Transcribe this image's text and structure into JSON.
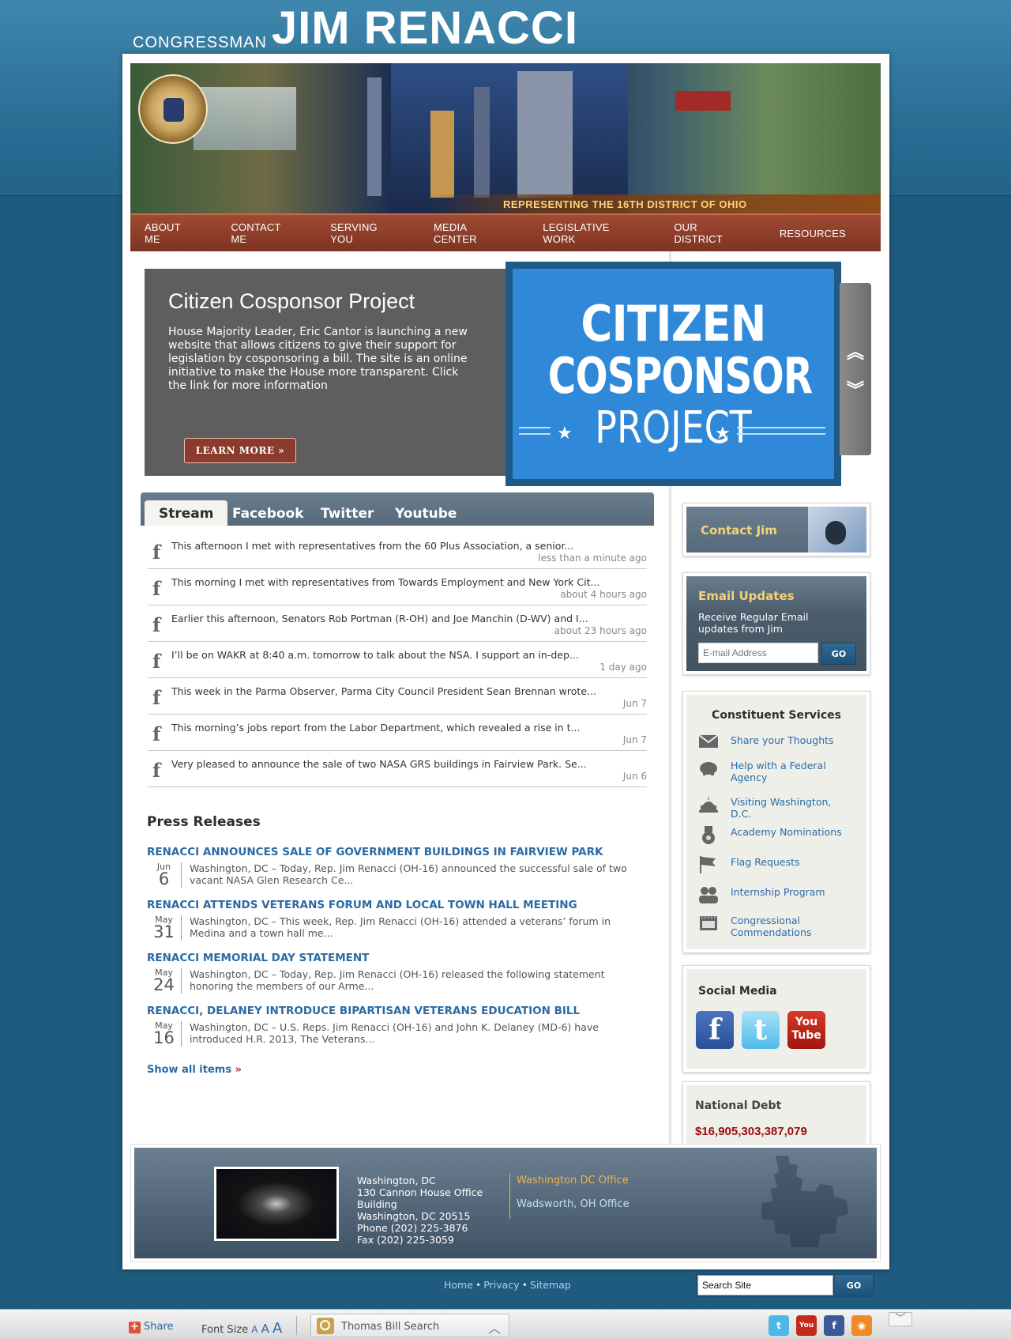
{
  "masthead": {
    "prefix": "CONGRESSMAN",
    "name": "JIM RENACCI"
  },
  "banner": {
    "district": "REPRESENTING THE 16TH DISTRICT OF OHIO"
  },
  "nav": [
    "ABOUT ME",
    "CONTACT ME",
    "SERVING YOU",
    "MEDIA CENTER",
    "LEGISLATIVE WORK",
    "OUR DISTRICT",
    "RESOURCES"
  ],
  "feature": {
    "title": "Citizen Cosponsor Project",
    "body": "House Majority Leader, Eric Cantor is launching a new website that allows citizens to give their support for legislation by cosponsoring a bill. The site is an online initiative to make the House more transparent. Click the link for more information",
    "button": "LEARN MORE »",
    "image_lines": [
      "CITIZEN",
      "COSPONSOR",
      "PROJECT"
    ],
    "up_icon": "double-chevron-up-icon",
    "down_icon": "double-chevron-down-icon"
  },
  "tabs": [
    "Stream",
    "Facebook",
    "Twitter",
    "Youtube"
  ],
  "stream": [
    {
      "text": "This afternoon I met with representatives from the 60 Plus Association, a senior...",
      "ago": "less than a minute ago"
    },
    {
      "text": "This morning I met with representatives from Towards Employment and New York Cit...",
      "ago": "about 4 hours ago"
    },
    {
      "text": "Earlier this afternoon, Senators Rob Portman (R-OH) and Joe Manchin (D-WV) and I...",
      "ago": "about 23 hours ago"
    },
    {
      "text": "I’ll be on WAKR at 8:40 a.m. tomorrow to talk about the NSA. I support an in-dep...",
      "ago": "1 day ago"
    },
    {
      "text": "This week in the Parma Observer, Parma City Council President Sean Brennan wrote...",
      "ago": "Jun 7"
    },
    {
      "text": "This morning’s jobs report from the Labor Department, which revealed a rise in t...",
      "ago": "Jun 7"
    },
    {
      "text": "Very pleased to announce the sale of two NASA GRS buildings in Fairview Park. Se...",
      "ago": "Jun 6"
    }
  ],
  "press": {
    "heading": "Press Releases",
    "items": [
      {
        "title": "RENACCI ANNOUNCES SALE OF GOVERNMENT BUILDINGS IN FAIRVIEW PARK",
        "month": "Jun",
        "day": "6",
        "summary": "Washington, DC – Today, Rep. Jim Renacci (OH-16) announced the successful sale of two vacant NASA Glen Research Ce..."
      },
      {
        "title": "RENACCI ATTENDS VETERANS FORUM AND LOCAL TOWN HALL MEETING",
        "month": "May",
        "day": "31",
        "summary": "Washington, DC – This week, Rep. Jim Renacci (OH-16) attended a veterans’ forum in Medina and a town hall me..."
      },
      {
        "title": "RENACCI MEMORIAL DAY STATEMENT",
        "month": "May",
        "day": "24",
        "summary": "Washington, DC – Today, Rep. Jim Renacci (OH-16) released the following statement honoring the members of our Arme..."
      },
      {
        "title": "RENACCI, DELANEY INTRODUCE BIPARTISAN VETERANS EDUCATION BILL",
        "month": "May",
        "day": "16",
        "summary": "Washington, DC – U.S. Reps. Jim Renacci (OH-16) and John K. Delaney (MD-6) have introduced H.R. 2013, The Veterans..."
      }
    ],
    "show_all": "Show all items",
    "show_all_arrow": "»"
  },
  "sidebar": {
    "contact": "Contact Jim",
    "email": {
      "heading": "Email Updates",
      "desc": "Receive Regular Email updates from Jim",
      "placeholder": "E-mail Address",
      "go": "GO"
    },
    "constituent": {
      "heading": "Constituent Services",
      "items": [
        {
          "label": "Share your Thoughts",
          "icon": "envelope-icon"
        },
        {
          "label": "Help with a Federal Agency",
          "icon": "piggy-bank-icon"
        },
        {
          "label": "Visiting Washington, D.C.",
          "icon": "capitol-icon"
        },
        {
          "label": "Academy Nominations",
          "icon": "medal-icon"
        },
        {
          "label": "Flag Requests",
          "icon": "flag-icon"
        },
        {
          "label": "Internship Program",
          "icon": "people-icon"
        },
        {
          "label": "Congressional Commendations",
          "icon": "certificate-icon"
        }
      ]
    },
    "social": {
      "heading": "Social Media",
      "facebook": "f",
      "twitter": "t",
      "youtube_top": "You",
      "youtube_bottom": "Tube"
    },
    "debt": {
      "heading": "National Debt",
      "value": "$16,905,303,387,079"
    }
  },
  "footer": {
    "address_lines": [
      "Washington, DC",
      "130 Cannon House Office Building",
      "Washington, DC 20515",
      "Phone (202) 225-3876",
      "Fax (202) 225-3059"
    ],
    "offices": [
      "Washington DC Office",
      "Wadsworth, OH Office"
    ]
  },
  "bottom_links": [
    "Home",
    "Privacy",
    "Sitemap"
  ],
  "search": {
    "value": "Search Site",
    "go": "GO"
  },
  "toolbar": {
    "share": "Share",
    "font_size_label": "Font Size",
    "font_a": [
      "A",
      "A",
      "A"
    ],
    "bill_search": "Thomas Bill Search",
    "colors": {
      "twitter": "#4fb6e8",
      "youtube": "#c4291c",
      "facebook": "#3b5998",
      "rss": "#f08a24"
    }
  }
}
